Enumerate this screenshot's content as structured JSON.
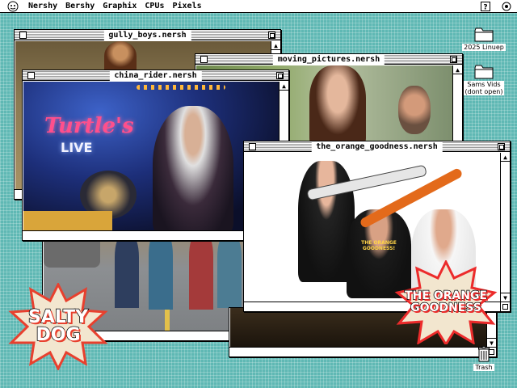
{
  "menubar": {
    "items": [
      "Nershy",
      "Bershy",
      "Graphix",
      "CPUs",
      "Pixels"
    ],
    "icons": {
      "apple": "apple-logo-icon",
      "help": "help-icon",
      "app_switch": "application-menu-icon"
    }
  },
  "windows": {
    "gully": {
      "title": "gully_boys.nersh"
    },
    "moving": {
      "title": "moving_pictures.nersh"
    },
    "china": {
      "title": "china_rider.nersh",
      "sign_line1": "Turtle's",
      "sign_line2": "LIVE"
    },
    "orange": {
      "title": "the_orange_goodness.nersh",
      "tee_text": "THE ORANGE GOODNESS!"
    }
  },
  "stickers": {
    "salty": {
      "line1": "SALTY",
      "line2": "DOG",
      "fill": "#e8402e"
    },
    "orange": {
      "line1": "THE ORANGE",
      "line2": "GOODNESS",
      "fill": "#ec2b2b"
    }
  },
  "desktop": {
    "icons": [
      {
        "label": "2025 Linuep"
      },
      {
        "label": "Sams Vids\n(dont open)"
      },
      {
        "label": "Trash"
      }
    ]
  },
  "colors": {
    "desktop": "#5fb8b4",
    "accent": "#e8402e"
  }
}
